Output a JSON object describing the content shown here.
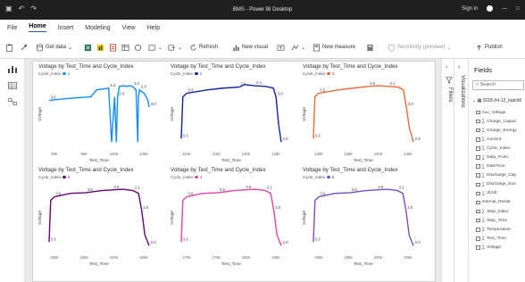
{
  "titlebar": {
    "title": "BMS - Power BI Desktop",
    "signin": "Sign in",
    "icons": [
      "save-icon",
      "undo-icon",
      "redo-icon"
    ],
    "win_buttons": [
      "—",
      "□"
    ]
  },
  "menu": {
    "tabs": [
      "File",
      "Home",
      "Insert",
      "Modeling",
      "View",
      "Help"
    ],
    "active": "Home"
  },
  "ribbon": {
    "get_data": "Get data",
    "refresh": "Refresh",
    "new_visual": "New visual",
    "new_measure": "New measure",
    "sensitivity": "Sensitivity (preview)",
    "publish": "Publish"
  },
  "panes": {
    "visualizations": "Visualizations",
    "filters": "Filters"
  },
  "fields": {
    "header": "Fields",
    "search_placeholder": "Search",
    "table_name": "2018-04-12_batch8",
    "items": [
      {
        "name": "Aux_Voltage",
        "sigma": false
      },
      {
        "name": "Charge_Capaci",
        "sigma": true
      },
      {
        "name": "Charge_Energy",
        "sigma": true
      },
      {
        "name": "Current",
        "sigma": true
      },
      {
        "name": "Cycle_Index",
        "sigma": true
      },
      {
        "name": "Data_Point",
        "sigma": true
      },
      {
        "name": "DateTime",
        "sigma": true
      },
      {
        "name": "Discharge_Cap",
        "sigma": true
      },
      {
        "name": "Discharge_Ene",
        "sigma": true
      },
      {
        "name": "dV/dt",
        "sigma": true
      },
      {
        "name": "Internal_Resist",
        "sigma": false
      },
      {
        "name": "Step_Index",
        "sigma": true
      },
      {
        "name": "Step_Time",
        "sigma": true
      },
      {
        "name": "Temperature",
        "sigma": true
      },
      {
        "name": "Test_Time",
        "sigma": true
      },
      {
        "name": "Voltage",
        "sigma": true
      }
    ]
  },
  "chart_data": [
    {
      "type": "line",
      "title": "Voltage by Test_Time and Cycle_Index",
      "legend_title": "Cycle_Index",
      "series": [
        {
          "name": "1",
          "color": "#118dff"
        }
      ],
      "xlabel": "Test_Time",
      "ylabel": "Voltage",
      "x_ticks": [
        "90K",
        "95K",
        "100K",
        "105K"
      ],
      "ylim": [
        1.8,
        3.8
      ],
      "x": [
        89000,
        92000,
        96000,
        97000,
        99000,
        99500,
        100000,
        100300,
        100500,
        100800,
        101500,
        102000,
        102500,
        103000,
        103600,
        103900,
        104000,
        104200,
        104500,
        105000,
        105600,
        105800
      ],
      "y": [
        3.2,
        3.25,
        3.3,
        3.5,
        3.55,
        2.0,
        3.3,
        2.0,
        3.3,
        3.6,
        3.62,
        3.6,
        3.62,
        3.6,
        3.5,
        2.0,
        3.3,
        3.5,
        3.45,
        3.4,
        3.2,
        3.0
      ],
      "data_labels": [
        "3.6",
        "3.2",
        "2.0",
        "2.0",
        "2.0",
        "3.0"
      ]
    },
    {
      "type": "line",
      "title": "Voltage by Test_Time and Cycle_Index",
      "legend_title": "Cycle_Index",
      "series": [
        {
          "name": "2",
          "color": "#12239e"
        }
      ],
      "xlabel": "Test_Time",
      "ylabel": "Voltage",
      "x_ticks": [
        "110K",
        "115K",
        "120K",
        "125K"
      ],
      "ylim": [
        1.8,
        3.8
      ],
      "x": [
        108000,
        108300,
        109000,
        113000,
        116000,
        119000,
        120000,
        122000,
        124000,
        125500,
        126000,
        126500,
        127000
      ],
      "y": [
        2.1,
        3.3,
        3.4,
        3.5,
        3.55,
        3.58,
        3.65,
        3.62,
        3.6,
        3.55,
        3.3,
        2.5,
        2.0
      ],
      "data_labels": [
        "3.3",
        "3.6",
        "3.6",
        "2.1",
        "3.0",
        "2.0"
      ]
    },
    {
      "type": "line",
      "title": "Voltage by Test_Time and Cycle_Index",
      "legend_title": "Cycle_Index",
      "series": [
        {
          "name": "3",
          "color": "#e66c37"
        }
      ],
      "xlabel": "Test_Time",
      "ylabel": "Voltage",
      "x_ticks": [
        "130K",
        "135K",
        "140K",
        "145K"
      ],
      "ylim": [
        1.8,
        3.8
      ],
      "x": [
        128000,
        128300,
        129000,
        133000,
        136000,
        139000,
        141000,
        143000,
        145000,
        146000,
        146600,
        147200,
        148000
      ],
      "y": [
        2.1,
        3.3,
        3.4,
        3.5,
        3.55,
        3.6,
        3.62,
        3.6,
        3.58,
        3.5,
        3.0,
        2.4,
        2.0
      ],
      "data_labels": [
        "3.3",
        "3.6",
        "3.6",
        "2.1",
        "3.0",
        "2.0"
      ]
    },
    {
      "type": "line",
      "title": "Voltage by Test_Time and Cycle_Index",
      "legend_title": "Cycle_Index",
      "series": [
        {
          "name": "5",
          "color": "#6b007b"
        }
      ],
      "xlabel": "Test_Time",
      "ylabel": "Voltage",
      "x_ticks": [
        "150K",
        "155K",
        "160K",
        "165K"
      ],
      "ylim": [
        1.8,
        3.8
      ],
      "x": [
        148000,
        148300,
        149000,
        152000,
        155000,
        158000,
        160000,
        162000,
        164000,
        165000,
        165600,
        166200,
        167000
      ],
      "y": [
        2.1,
        3.3,
        3.4,
        3.5,
        3.52,
        3.58,
        3.6,
        3.62,
        3.58,
        3.5,
        3.0,
        2.3,
        2.0
      ],
      "data_labels": [
        "3.3",
        "3.6",
        "3.6",
        "3.6",
        "2.1",
        "3.0",
        "2.0"
      ]
    },
    {
      "type": "line",
      "title": "Voltage by Test_Time and Cycle_Index",
      "legend_title": "Cycle_Index",
      "series": [
        {
          "name": "4",
          "color": "#e044a7"
        }
      ],
      "xlabel": "Test_Time",
      "ylabel": "Voltage",
      "x_ticks": [
        "170K",
        "175K",
        "180K",
        "185K"
      ],
      "ylim": [
        1.8,
        3.8
      ],
      "x": [
        168000,
        168300,
        169000,
        172000,
        175000,
        178000,
        180000,
        182000,
        184000,
        185000,
        185600,
        186200,
        187000
      ],
      "y": [
        2.1,
        3.3,
        3.4,
        3.5,
        3.52,
        3.58,
        3.6,
        3.62,
        3.58,
        3.5,
        3.0,
        2.3,
        2.0
      ],
      "data_labels": [
        "3.3",
        "3.6",
        "3.6",
        "3.6",
        "2.1",
        "3.0",
        "2.0"
      ]
    },
    {
      "type": "line",
      "title": "Voltage by Test_Time and Cycle_Index",
      "legend_title": "Cycle_Index",
      "series": [
        {
          "name": "6",
          "color": "#744ec2"
        }
      ],
      "xlabel": "Test_Time",
      "ylabel": "Voltage",
      "x_ticks": [
        "190K",
        "195K",
        "200K",
        "205K"
      ],
      "ylim": [
        1.8,
        3.8
      ],
      "x": [
        188000,
        188300,
        189000,
        192000,
        195000,
        198000,
        200000,
        202000,
        204000,
        205000,
        205600,
        206200,
        207000
      ],
      "y": [
        2.1,
        3.3,
        3.4,
        3.5,
        3.52,
        3.58,
        3.6,
        3.62,
        3.58,
        3.5,
        3.0,
        2.3,
        2.0
      ],
      "data_labels": [
        "3.3",
        "3.6",
        "3.6",
        "3.6",
        "2.1",
        "3.0",
        "2.0"
      ]
    }
  ]
}
